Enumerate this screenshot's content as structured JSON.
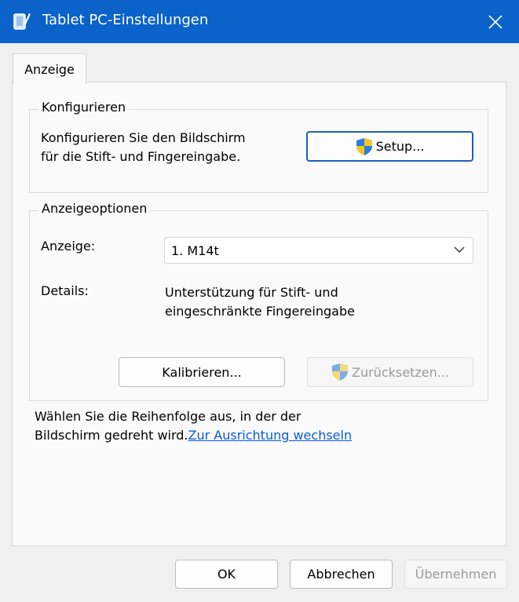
{
  "window": {
    "title": "Tablet PC-Einstellungen",
    "icon": "tablet-pc-icon",
    "accent": "#0b62c9"
  },
  "tabs": [
    {
      "label": "Anzeige"
    }
  ],
  "configure": {
    "legend": "Konfigurieren",
    "description": "Konfigurieren Sie den Bildschirm\nfür die Stift- und Fingereingabe.",
    "setup_label": "Setup..."
  },
  "display_options": {
    "legend": "Anzeigeoptionen",
    "display_label": "Anzeige:",
    "display_value": "1. M14t",
    "details_label": "Details:",
    "details_value": "Unterstützung für Stift- und\neingeschränkte Fingereingabe",
    "calibrate_label": "Kalibrieren...",
    "reset_label": "Zurücksetzen..."
  },
  "orientation": {
    "text": "Wählen Sie die Reihenfolge aus, in der der Bildschirm gedreht wird.",
    "link": "Zur Ausrichtung wechseln"
  },
  "footer": {
    "ok": "OK",
    "cancel": "Abbrechen",
    "apply": "Übernehmen"
  }
}
